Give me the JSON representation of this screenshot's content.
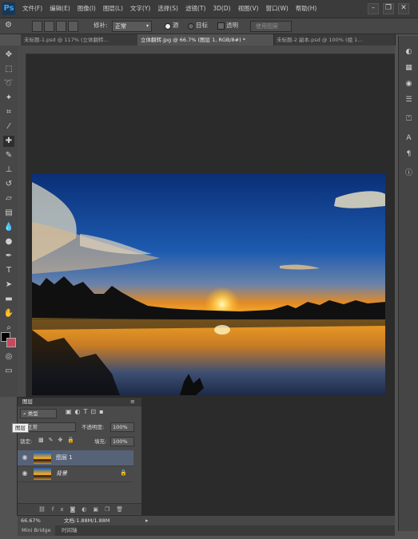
{
  "menubar": {
    "logo": "Ps",
    "items": [
      "文件(F)",
      "编辑(E)",
      "图像(I)",
      "图层(L)",
      "文字(Y)",
      "选择(S)",
      "滤镜(T)",
      "3D(D)",
      "视图(V)",
      "窗口(W)",
      "帮助(H)"
    ],
    "window_buttons": [
      "–",
      "❐",
      "✕"
    ]
  },
  "options": {
    "mode_label": "修补:",
    "mode_value": "正常",
    "source_label": "源",
    "dest_label": "目标",
    "transparent_label": "透明",
    "use_pattern_label": "使用图案"
  },
  "tabs": [
    {
      "label": "未标题-1.psd @ 117% (立体翻转…",
      "active": false
    },
    {
      "label": "立体翻转.jpg @ 66.7% (图层 1, RGB/8#) *",
      "active": true
    },
    {
      "label": "未标题-2 副本.psd @ 100% (组 1…",
      "active": false
    }
  ],
  "layers_panel": {
    "title": "图层",
    "filter_value": "类型",
    "blend_mode": "正常",
    "opacity_label": "不透明度:",
    "opacity_value": "100%",
    "lock_label": "锁定:",
    "fill_label": "填充:",
    "fill_value": "100%",
    "layers": [
      {
        "name": "图层 1",
        "selected": true
      },
      {
        "name": "背景",
        "selected": false
      }
    ]
  },
  "tooltip": "图层",
  "status": {
    "zoom": "66.67%",
    "doc_info": "文档:1.88M/1.88M"
  },
  "bottom_tabs": [
    "Mini Bridge",
    "时间轴"
  ]
}
